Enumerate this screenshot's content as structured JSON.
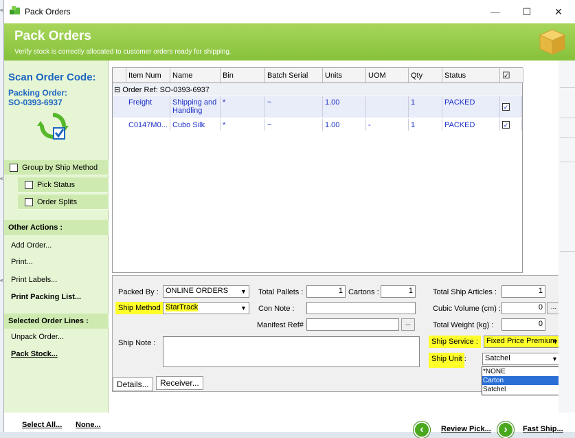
{
  "window": {
    "title": "Pack Orders",
    "minimize": "—",
    "maximize": "☐",
    "close": "✕"
  },
  "banner": {
    "title": "Pack Orders",
    "subtitle": "Verify stock is correctly allocated to customer orders ready for shipping."
  },
  "left": {
    "scan_title": "Scan Order Code:",
    "packing_order_label": "Packing Order:",
    "packing_order_value": "SO-0393-6937",
    "options": [
      {
        "label": "Group by Ship Method",
        "checked": false
      },
      {
        "label": "Pick Status",
        "checked": false
      },
      {
        "label": "Order Splits",
        "checked": false
      }
    ],
    "other_actions_title": "Other Actions :",
    "other_actions": [
      "Add Order...",
      "Print...",
      "Print Labels...",
      "Print Packing List..."
    ],
    "selected_lines_title": "Selected Order Lines :",
    "selected_actions": [
      "Unpack Order...",
      "Pack Stock..."
    ]
  },
  "grid": {
    "headers": [
      "Item Num",
      "Name",
      "Bin",
      "Batch Serial",
      "Units",
      "UOM",
      "Qty",
      "Status",
      "☑"
    ],
    "group_label": "Order Ref: SO-0393-6937",
    "group_toggle": "⊟",
    "rows": [
      {
        "item": "Freight",
        "name": "Shipping and Handling",
        "bin": "*",
        "batch": "~",
        "units": "1.00",
        "uom": "",
        "qty": "1",
        "status": "PACKED",
        "checked": "✓"
      },
      {
        "item": "C0147M0...",
        "name": "Cubo Silk",
        "bin": "*",
        "batch": "~",
        "units": "1.00",
        "uom": "-",
        "qty": "1",
        "status": "PACKED",
        "checked": "✓"
      }
    ]
  },
  "form": {
    "packed_by_label": "Packed By :",
    "packed_by_value": "ONLINE ORDERS",
    "ship_method_label": "Ship Method :",
    "ship_method_value": "StarTrack",
    "ship_note_label": "Ship Note :",
    "total_pallets_label": "Total Pallets :",
    "total_pallets_value": "1",
    "cartons_label": "Cartons :",
    "cartons_value": "1",
    "con_note_label": "Con Note :",
    "manifest_label": "Manifest Ref# :",
    "manifest_btn": "...",
    "total_articles_label": "Total Ship Articles :",
    "total_articles_value": "1",
    "cubic_label": "Cubic Volume (cm) :",
    "cubic_value": "0",
    "cubic_btn": "...",
    "weight_label": "Total Weight (kg) :",
    "weight_value": "0",
    "ship_service_label": "Ship Service :",
    "ship_service_value": "Fixed Price Premium",
    "ship_unit_label": "Ship Unit :",
    "ship_unit_value": "Satchel",
    "ship_unit_options": [
      "*NONE",
      "Carton",
      "Satchel"
    ],
    "ship_unit_highlighted": "Carton",
    "tabs": [
      "Details...",
      "Receiver..."
    ]
  },
  "bottom": {
    "select_all": "Select All...",
    "none": "None...",
    "review_pick": "Review Pick...",
    "fast_ship": "Fast Ship..."
  },
  "colors": {
    "banner_green": "#8cc63f",
    "left_panel": "#e6f5d4",
    "highlight_yellow": "#ffff2a",
    "link_blue": "#1d66c2"
  }
}
